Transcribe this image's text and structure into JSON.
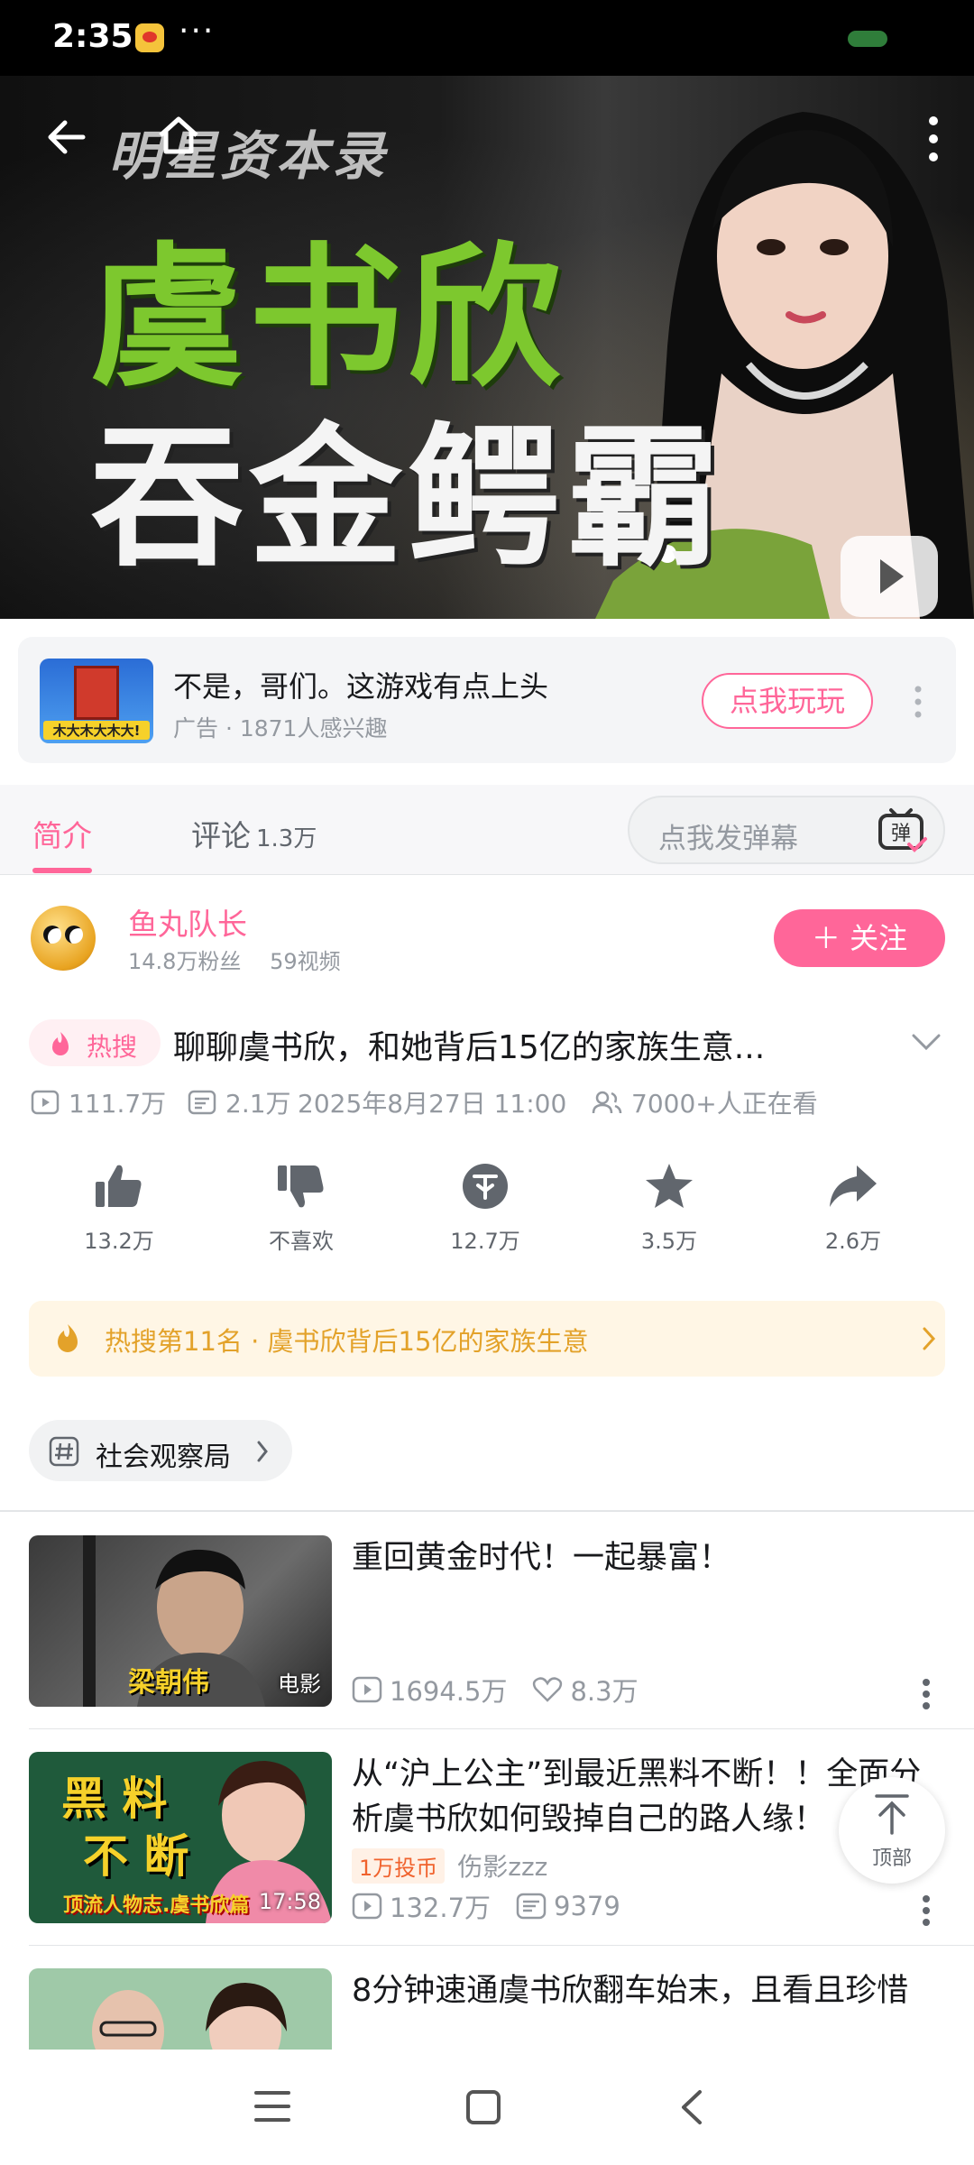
{
  "status_bar": {
    "time": "2:35",
    "more": "···"
  },
  "video": {
    "subtitle": "明星资本录",
    "name": "虞书欣",
    "slogan": "吞金鳄霸"
  },
  "ad": {
    "thumb_caption": "木大木大木大!",
    "title": "不是，哥们。这游戏有点上头",
    "meta": "广告 · 1871人感兴趣",
    "cta": "点我玩玩"
  },
  "tabs": {
    "intro": "简介",
    "comments": "评论",
    "comments_count": "1.3万",
    "danmaku_placeholder": "点我发弹幕",
    "danmaku_icon_char": "弹"
  },
  "uploader": {
    "name": "鱼丸队长",
    "fans": "14.8万粉丝",
    "videos": "59视频",
    "follow": "＋ 关注"
  },
  "video_info": {
    "hot_tag": "热搜",
    "title": "聊聊虞书欣，和她背后15亿的家族生意...",
    "plays": "111.7万",
    "danmaku": "2.1万",
    "date": "2025年8月27日 11:00",
    "watching": "7000+人正在看"
  },
  "actions": {
    "like": "13.2万",
    "dislike": "不喜欢",
    "coin": "12.7万",
    "favorite": "3.5万",
    "share": "2.6万"
  },
  "trending": {
    "text": "热搜第11名 · 虞书欣背后15亿的家族生意"
  },
  "topic": {
    "label": "社会观察局"
  },
  "recommendations": [
    {
      "title": "重回黄金时代！一起暴富！",
      "thumb_badge": "电影",
      "thumb_caption": "梁朝伟",
      "plays": "1694.5万",
      "likes": "8.3万"
    },
    {
      "title": "从“沪上公主”到最近黑料不断！！全面分析虞书欣如何毁掉自己的路人缘！",
      "thumb_badge": "17:58",
      "thumb_text_1": "黑 料",
      "thumb_text_2": "不 断",
      "thumb_caption": "顶流人物志.虞书欣篇",
      "coin_tag": "1万投币",
      "uploader": "伤影zzz",
      "plays": "132.7万",
      "danmaku": "9379"
    },
    {
      "title": "8分钟速通虞书欣翻车始末，且看且珍惜"
    }
  ],
  "to_top": {
    "label": "顶部"
  },
  "colors": {
    "accent": "#ff6699",
    "trending": "#e3a22a",
    "muted": "#9499a0"
  }
}
